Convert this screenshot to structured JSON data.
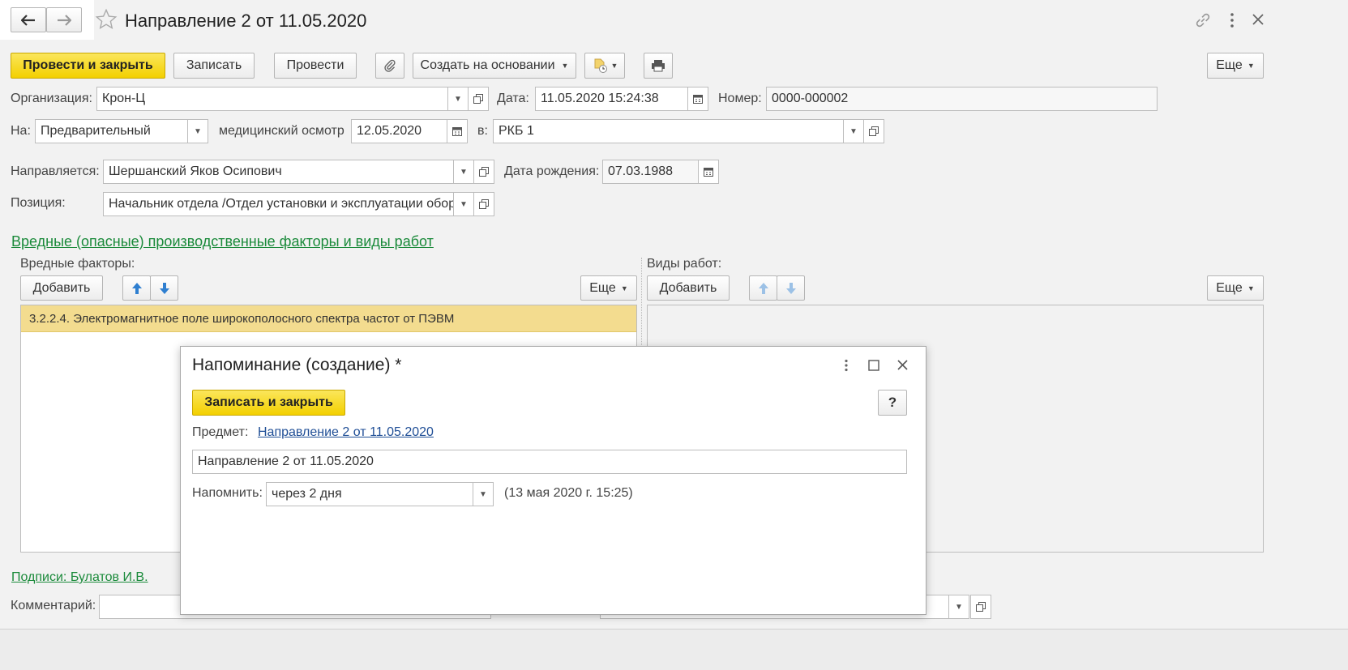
{
  "window": {
    "title": "Направление 2 от 11.05.2020"
  },
  "toolbar": {
    "post_close": "Провести и закрыть",
    "save": "Записать",
    "post": "Провести",
    "create_based": "Создать на основании",
    "more": "Еще"
  },
  "header": {
    "org_label": "Организация:",
    "org_value": "Крон-Ц",
    "date_label": "Дата:",
    "date_value": "11.05.2020 15:24:38",
    "number_label": "Номер:",
    "number_value": "0000-000002",
    "to_label": "На:",
    "to_value": "Предварительный",
    "exam_label": "медицинский осмотр",
    "exam_date": "12.05.2020",
    "in_label": "в:",
    "in_value": "РКБ 1",
    "sent_label": "Направляется:",
    "sent_value": "Шершанский Яков Осипович",
    "birth_label": "Дата рождения:",
    "birth_value": "07.03.1988",
    "position_label": "Позиция:",
    "position_value": "Начальник отдела /Отдел установки и эксплуатации обор"
  },
  "section": {
    "title": "Вредные (опасные) производственные факторы и виды работ",
    "factors_label": "Вредные факторы:",
    "works_label": "Виды работ:",
    "add": "Добавить",
    "more": "Еще",
    "factors_rows": [
      "3.2.2.4. Электромагнитное поле широкополосного спектра частот от ПЭВМ"
    ]
  },
  "footer": {
    "signatures_link": "Подписи: Булатов И.В.",
    "comment_label": "Комментарий:"
  },
  "dialog": {
    "title": "Напоминание (создание) *",
    "save_close": "Записать и закрыть",
    "help": "?",
    "subject_label": "Предмет:",
    "subject_link": "Направление 2 от 11.05.2020",
    "text_value": "Направление 2 от 11.05.2020",
    "remind_label": "Напомнить:",
    "remind_value": "через 2 дня",
    "remind_when": "(13 мая 2020 г. 15:25)"
  },
  "colors": {
    "primary_button": "#f5d400",
    "selected_row": "#f3dc8f",
    "link_green": "#1a8a3a",
    "link_blue": "#1f4e96"
  }
}
